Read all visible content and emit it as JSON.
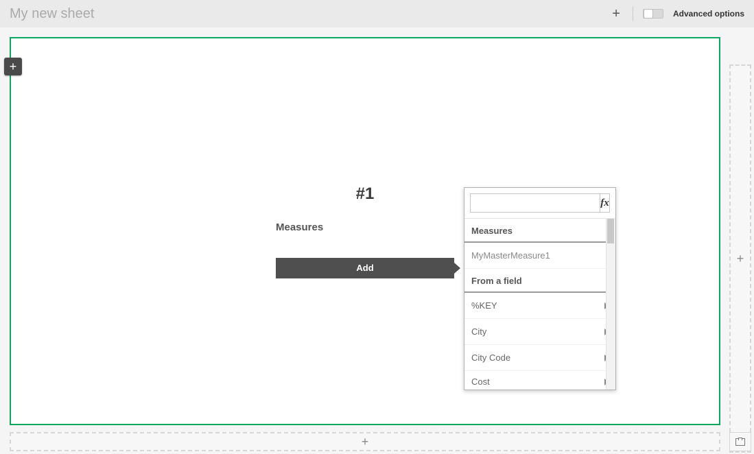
{
  "topbar": {
    "sheet_title": "My new sheet",
    "advanced_label": "Advanced options"
  },
  "canvas": {
    "placeholder_number": "#1",
    "measures_label": "Measures",
    "add_label": "Add"
  },
  "picker": {
    "search_placeholder": "",
    "fx_label": "fx",
    "sections": {
      "measures_header": "Measures",
      "from_field_header": "From a field"
    },
    "master_items": [
      {
        "label": "MyMasterMeasure1"
      }
    ],
    "field_items": [
      {
        "label": "%KEY"
      },
      {
        "label": "City"
      },
      {
        "label": "City Code"
      },
      {
        "label": "Cost"
      }
    ]
  },
  "icons": {
    "plus": "+"
  }
}
